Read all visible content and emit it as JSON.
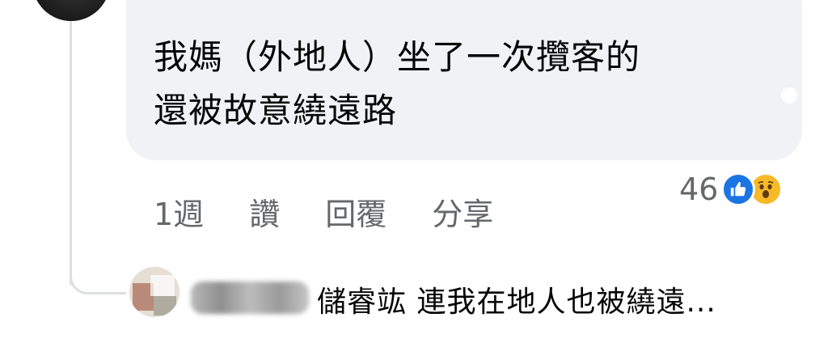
{
  "comment": {
    "author_name": "",
    "text_line1": "我媽（外地人）坐了一次攬客的",
    "text_line2": "還被故意繞遠路"
  },
  "actions": {
    "time": "1週",
    "like": "讚",
    "reply": "回覆",
    "share": "分享"
  },
  "reactions": {
    "count": "46",
    "icons": [
      "like-icon",
      "wow-icon"
    ],
    "colors": {
      "like": "#1b74e4",
      "wow": "#f7b928"
    }
  },
  "reply_preview": {
    "text": "儲睿竑 連我在地人也被繞遠..."
  }
}
